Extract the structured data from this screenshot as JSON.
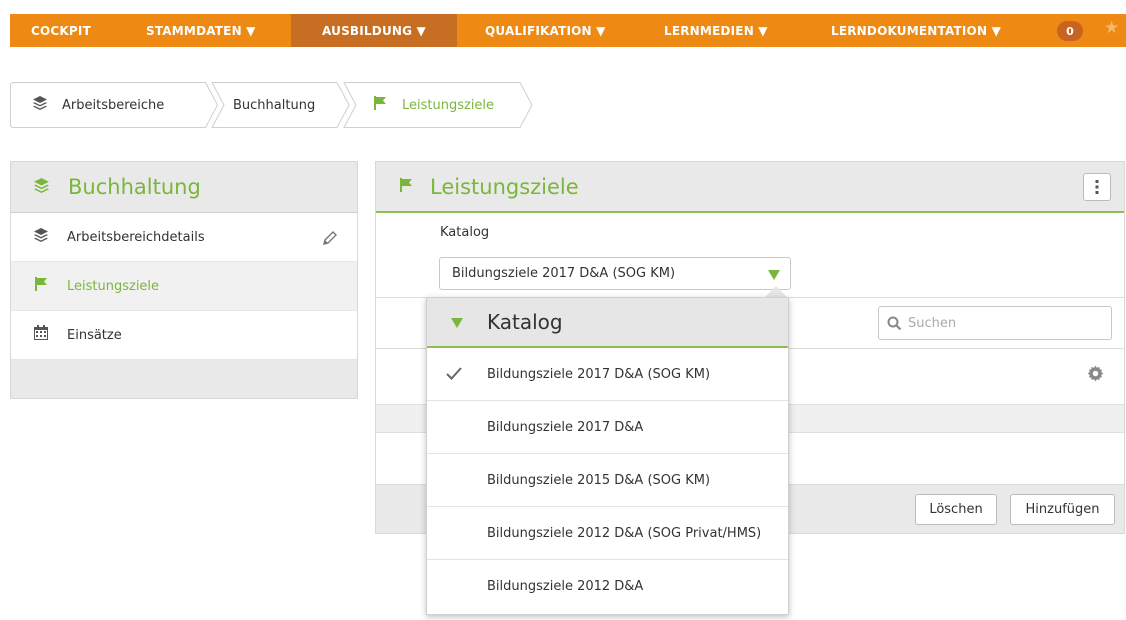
{
  "nav": {
    "items": [
      "COCKPIT",
      "STAMMDATEN ▼",
      "AUSBILDUNG ▼",
      "QUALIFIKATION ▼",
      "LERNMEDIEN ▼",
      "LERNDOKUMENTATION ▼"
    ],
    "active_index": 2,
    "badge": "0",
    "star_icon": "star-icon"
  },
  "breadcrumb": [
    "Arbeitsbereiche",
    "Buchhaltung",
    "Leistungsziele"
  ],
  "left_panel": {
    "title": "Buchhaltung",
    "items": [
      "Arbeitsbereichdetails",
      "Leistungsziele",
      "Einsätze"
    ]
  },
  "right_panel": {
    "title": "Leistungsziele",
    "katalog_label": "Katalog",
    "katalog_value": "Bildungsziele 2017 D&A (SOG KM)",
    "search_placeholder": "Suchen",
    "buttons": {
      "delete": "Löschen",
      "add": "Hinzufügen"
    }
  },
  "dropdown": {
    "title": "Katalog",
    "options": [
      "Bildungsziele 2017 D&A (SOG KM)",
      "Bildungsziele 2017 D&A",
      "Bildungsziele 2015 D&A (SOG KM)",
      "Bildungsziele 2012 D&A (SOG Privat/HMS)",
      "Bildungsziele 2012 D&A"
    ],
    "selected_index": 0
  },
  "colors": {
    "nav_orange": "#ee8a13",
    "nav_active": "#c86e22",
    "accent_green": "#7bb63c",
    "panel_gray": "#e9e9e9"
  }
}
